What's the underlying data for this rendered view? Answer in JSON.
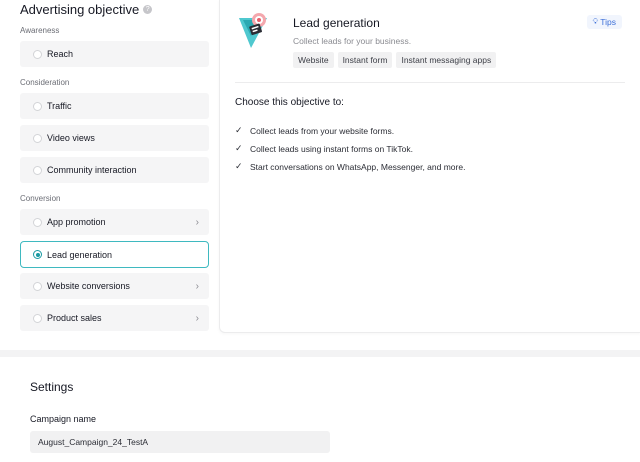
{
  "objective": {
    "title": "Advertising objective",
    "groups": {
      "awareness": "Awareness",
      "consideration": "Consideration",
      "conversion": "Conversion"
    },
    "options": {
      "reach": "Reach",
      "traffic": "Traffic",
      "video_views": "Video views",
      "community": "Community interaction",
      "app_promotion": "App promotion",
      "lead_generation": "Lead generation",
      "website_conversions": "Website conversions",
      "product_sales": "Product sales"
    },
    "selected": "lead_generation"
  },
  "detail": {
    "title": "Lead generation",
    "subtitle": "Collect leads for your business.",
    "tags": [
      "Website",
      "Instant form",
      "Instant messaging apps"
    ],
    "tips_label": "Tips",
    "heading": "Choose this objective to:",
    "benefits": [
      "Collect leads from your website forms.",
      "Collect leads using instant forms on TikTok.",
      "Start conversations on WhatsApp, Messenger, and more."
    ]
  },
  "settings": {
    "title": "Settings",
    "campaign_name_label": "Campaign name",
    "campaign_name_value": "August_Campaign_24_TestA"
  },
  "colors": {
    "accent": "#1b9aa3",
    "selected_border": "#3fb9c0",
    "tips_blue": "#3c6fd8"
  },
  "icons": {
    "info": "info-icon",
    "radio": "radio-icon",
    "chevron": "chevron-right-icon",
    "tips": "lightbulb-icon",
    "check": "check-icon",
    "hero": "lead-generation-illustration-icon"
  }
}
